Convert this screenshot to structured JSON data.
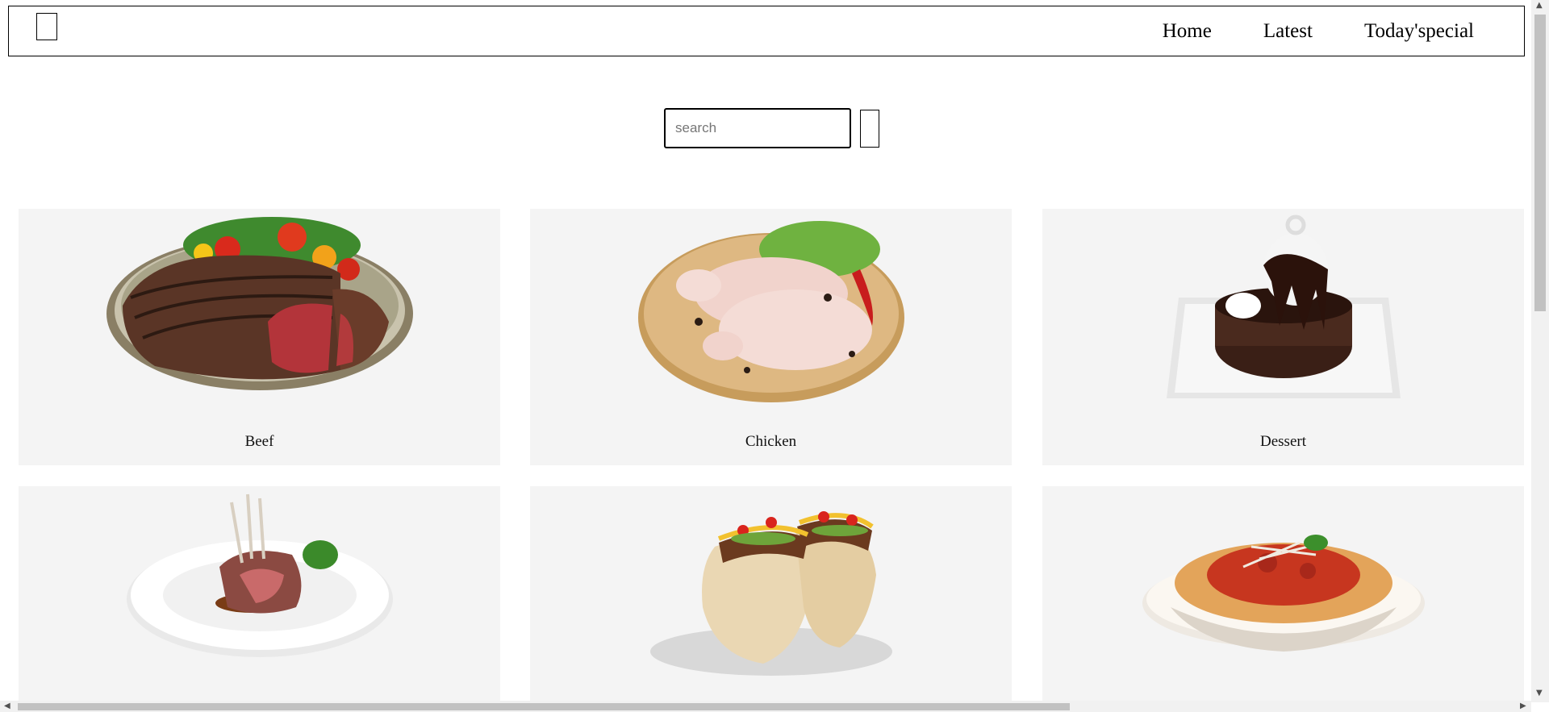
{
  "header": {
    "logo_icon": "logo-placeholder",
    "nav": [
      {
        "label": "Home"
      },
      {
        "label": "Latest"
      },
      {
        "label": "Today'special"
      }
    ]
  },
  "search": {
    "placeholder": "search",
    "value": "",
    "button_icon": "search-icon"
  },
  "categories": [
    {
      "label": "Beef"
    },
    {
      "label": "Chicken"
    },
    {
      "label": "Dessert"
    },
    {
      "label": ""
    },
    {
      "label": ""
    },
    {
      "label": ""
    }
  ],
  "colors": {
    "card_background": "#f4f4f4",
    "border": "#000000",
    "scrollbar_thumb": "#c1c1c1"
  }
}
